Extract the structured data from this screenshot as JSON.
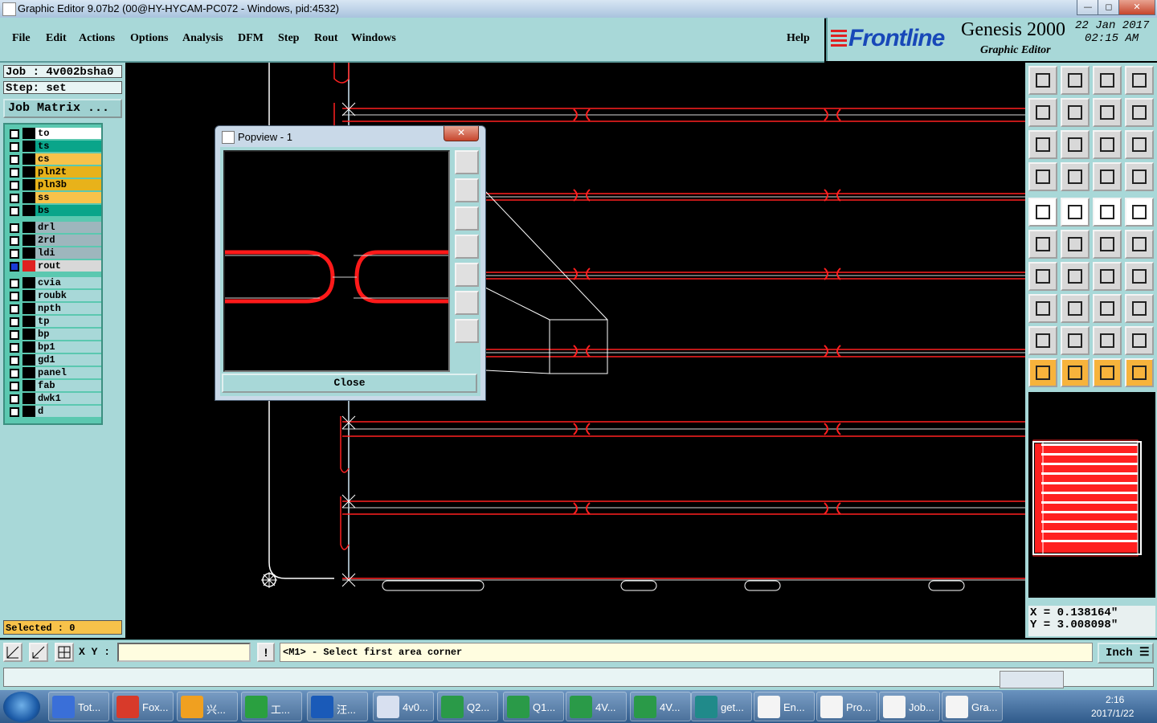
{
  "window": {
    "title": "Graphic Editor 9.07b2 (00@HY-HYCAM-PC072 - Windows, pid:4532)",
    "min": "—",
    "max": "◻",
    "close": "✕"
  },
  "menu": {
    "items": [
      "File",
      "Edit",
      "Actions",
      "Options",
      "Analysis",
      "DFM",
      "Step",
      "Rout",
      "Windows"
    ],
    "help": "Help"
  },
  "brand": {
    "logo": "Frontline",
    "product": "Genesis 2000",
    "subtitle": "Graphic Editor",
    "date": "22 Jan 2017",
    "time": "02:15 AM"
  },
  "job": {
    "job_label": "Job : 4v002bsha0",
    "step_label": "Step: set",
    "matrix_button": "Job Matrix ..."
  },
  "layers": [
    {
      "name": "to",
      "color": "#ffffff"
    },
    {
      "name": "ts",
      "color": "#0aa58a"
    },
    {
      "name": "cs",
      "color": "#f7c24a"
    },
    {
      "name": "pln2t",
      "color": "#e8b21a"
    },
    {
      "name": "pln3b",
      "color": "#e8b21a"
    },
    {
      "name": "ss",
      "color": "#f7c24a"
    },
    {
      "name": "bs",
      "color": "#0aa58a"
    },
    {
      "name": "drl",
      "color": "#9eb6bd"
    },
    {
      "name": "2rd",
      "color": "#9eb6bd"
    },
    {
      "name": "ldi",
      "color": "#9eb6bd"
    },
    {
      "name": "rout",
      "color": "#d8d8d8"
    },
    {
      "name": "cvia",
      "color": "#a8d8d8"
    },
    {
      "name": "roubk",
      "color": "#a8d8d8"
    },
    {
      "name": "npth",
      "color": "#a8d8d8"
    },
    {
      "name": "tp",
      "color": "#a8d8d8"
    },
    {
      "name": "bp",
      "color": "#a8d8d8"
    },
    {
      "name": "bp1",
      "color": "#a8d8d8"
    },
    {
      "name": "gd1",
      "color": "#a8d8d8"
    },
    {
      "name": "panel",
      "color": "#a8d8d8"
    },
    {
      "name": "fab",
      "color": "#a8d8d8"
    },
    {
      "name": "dwk1",
      "color": "#a8d8d8"
    },
    {
      "name": "d",
      "color": "#a8d8d8"
    }
  ],
  "selected": "Selected : 0",
  "coords": {
    "x": "X = 0.138164\"",
    "y": "Y = 3.008098\""
  },
  "bottom": {
    "xy_label": "X Y :",
    "xy_value": "",
    "excl": "!",
    "prompt": "<M1> - Select first area corner",
    "unit": "Inch ☰"
  },
  "popview": {
    "title": "Popview - 1",
    "close_x": "✕",
    "close_button": "Close"
  },
  "taskbar": {
    "tasks": [
      {
        "label": "Tot...",
        "color": "#3a6fd8"
      },
      {
        "label": "Fox...",
        "color": "#d83a2a"
      },
      {
        "label": "兴...",
        "color": "#f0a020"
      },
      {
        "label": "工...",
        "color": "#2aa040"
      },
      {
        "label": "汪...",
        "color": "#1a5ab8"
      },
      {
        "label": "4v0...",
        "color": "#d8e0f0"
      },
      {
        "label": "Q2...",
        "color": "#2a9a48"
      },
      {
        "label": "Q1...",
        "color": "#2a9a48"
      },
      {
        "label": "4V...",
        "color": "#2a9a48"
      },
      {
        "label": "4V...",
        "color": "#2a9a48"
      },
      {
        "label": "get...",
        "color": "#208a8a"
      },
      {
        "label": "En...",
        "color": "#f4f4f4"
      },
      {
        "label": "Pro...",
        "color": "#f4f4f4"
      },
      {
        "label": "Job...",
        "color": "#f4f4f4"
      },
      {
        "label": "Gra...",
        "color": "#f4f4f4"
      }
    ],
    "time": "2:16",
    "date": "2017/1/22"
  }
}
